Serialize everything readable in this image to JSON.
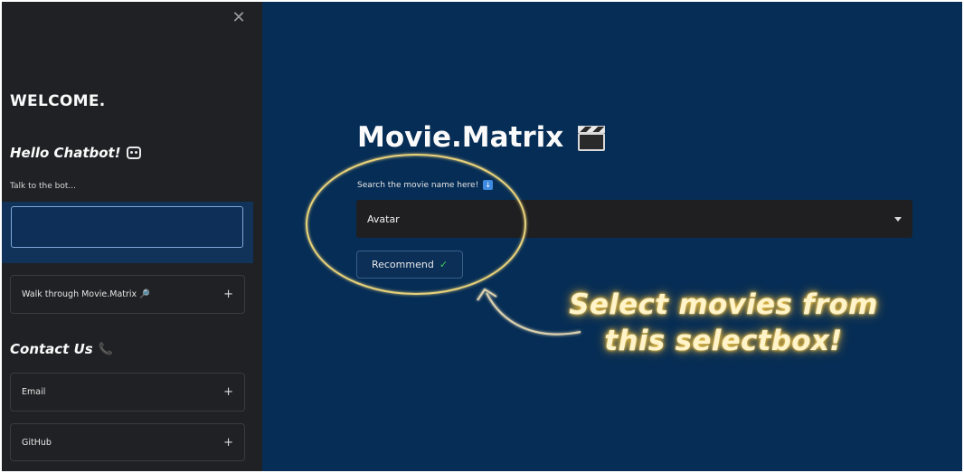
{
  "sidebar": {
    "close_icon": "close-icon",
    "welcome": "WELCOME.",
    "chatbot_title": "Hello Chatbot!",
    "chat_label": "Talk to the bot...",
    "chat_value": "",
    "expanders": {
      "walkthrough": "Walk through Movie.Matrix 🔎",
      "email": "Email",
      "github": "GitHub"
    },
    "contact_title": "Contact Us"
  },
  "main": {
    "title": "Movie.Matrix",
    "search_label": "Search the movie name here!",
    "selected_movie": "Avatar",
    "recommend_label": "Recommend",
    "annotation_line1": "Select movies from",
    "annotation_line2": "this selectbox!"
  },
  "colors": {
    "sidebar_bg": "#202124",
    "main_bg": "#062d55",
    "accent_glow": "#f2c94c"
  }
}
